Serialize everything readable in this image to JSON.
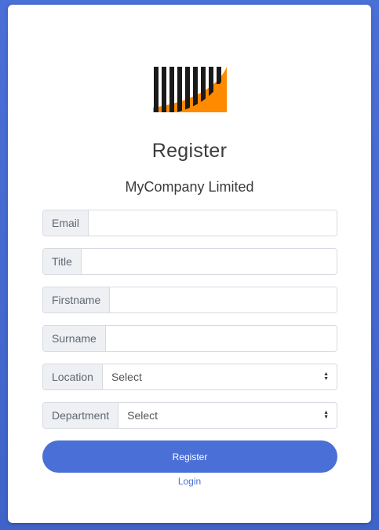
{
  "page": {
    "title": "Register",
    "company": "MyCompany Limited"
  },
  "form": {
    "email": {
      "label": "Email",
      "value": ""
    },
    "title": {
      "label": "Title",
      "value": ""
    },
    "firstname": {
      "label": "Firstname",
      "value": ""
    },
    "surname": {
      "label": "Surname",
      "value": ""
    },
    "location": {
      "label": "Location",
      "selected": "Select"
    },
    "department": {
      "label": "Department",
      "selected": "Select"
    }
  },
  "actions": {
    "register_label": "Register",
    "login_label": "Login"
  },
  "colors": {
    "accent": "#4a6fd6",
    "logo_orange": "#ff8a00",
    "logo_dark": "#1a1a1a"
  }
}
